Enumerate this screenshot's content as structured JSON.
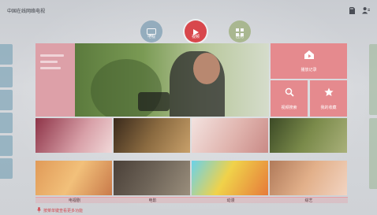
{
  "app_title": "中国在线网络电视",
  "status_icons": [
    "memory-card-icon",
    "user-settings-icon"
  ],
  "modes": [
    {
      "label": "电视",
      "icon": "tv-icon",
      "color": "#7f9fb4",
      "active": false
    },
    {
      "label": "视频",
      "icon": "play-icon",
      "color": "#d8474c",
      "active": true
    },
    {
      "label": "应用",
      "icon": "apps-grid-icon",
      "color": "#9fb07e",
      "active": false
    }
  ],
  "actions": {
    "history": {
      "label": "播放记录",
      "icon": "play-history-icon"
    },
    "search": {
      "label": "视频搜索",
      "icon": "search-icon"
    },
    "favorites": {
      "label": "我的收藏",
      "icon": "star-icon"
    }
  },
  "categories": [
    "电视剧",
    "电影",
    "动漫",
    "综艺"
  ],
  "hint": "按菜单键查看更多功能",
  "colors": {
    "accent_pink": "#e58a8e",
    "hero_side": "#dda0a8",
    "hint_red": "#d04850"
  }
}
